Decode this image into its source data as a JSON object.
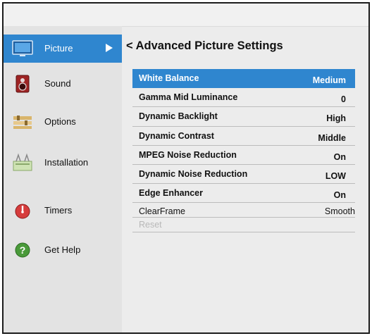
{
  "sidebar": {
    "items": [
      {
        "label": "Picture",
        "icon": "tv-icon",
        "active": true
      },
      {
        "label": "Sound",
        "icon": "speaker-icon"
      },
      {
        "label": "Options",
        "icon": "options-icon"
      },
      {
        "label": "Installation",
        "icon": "installation-icon"
      },
      {
        "label": "Timers",
        "icon": "timer-icon"
      },
      {
        "label": "Get Help",
        "icon": "help-icon"
      }
    ]
  },
  "main": {
    "back_symbol": "<",
    "title": "Advanced Picture Settings",
    "settings": [
      {
        "name": "White Balance",
        "value": "Medium"
      },
      {
        "name": "Gamma Mid Luminance",
        "value": "0"
      },
      {
        "name": "Dynamic Backlight",
        "value": "High"
      },
      {
        "name": "Dynamic Contrast",
        "value": "Middle"
      },
      {
        "name": "MPEG Noise Reduction",
        "value": "On"
      },
      {
        "name": "Dynamic Noise Reduction",
        "value": "LOW"
      },
      {
        "name": "Edge Enhancer",
        "value": "On"
      },
      {
        "name": "ClearFrame",
        "value": "Smooth"
      },
      {
        "name": "Reset",
        "value": ""
      }
    ]
  },
  "colors": {
    "accent": "#2f86cf",
    "frame": "#1c1c1c",
    "sidebar_bg": "#e3e3e3",
    "main_bg": "#ececec",
    "disabled_text": "#b8b8b8"
  }
}
